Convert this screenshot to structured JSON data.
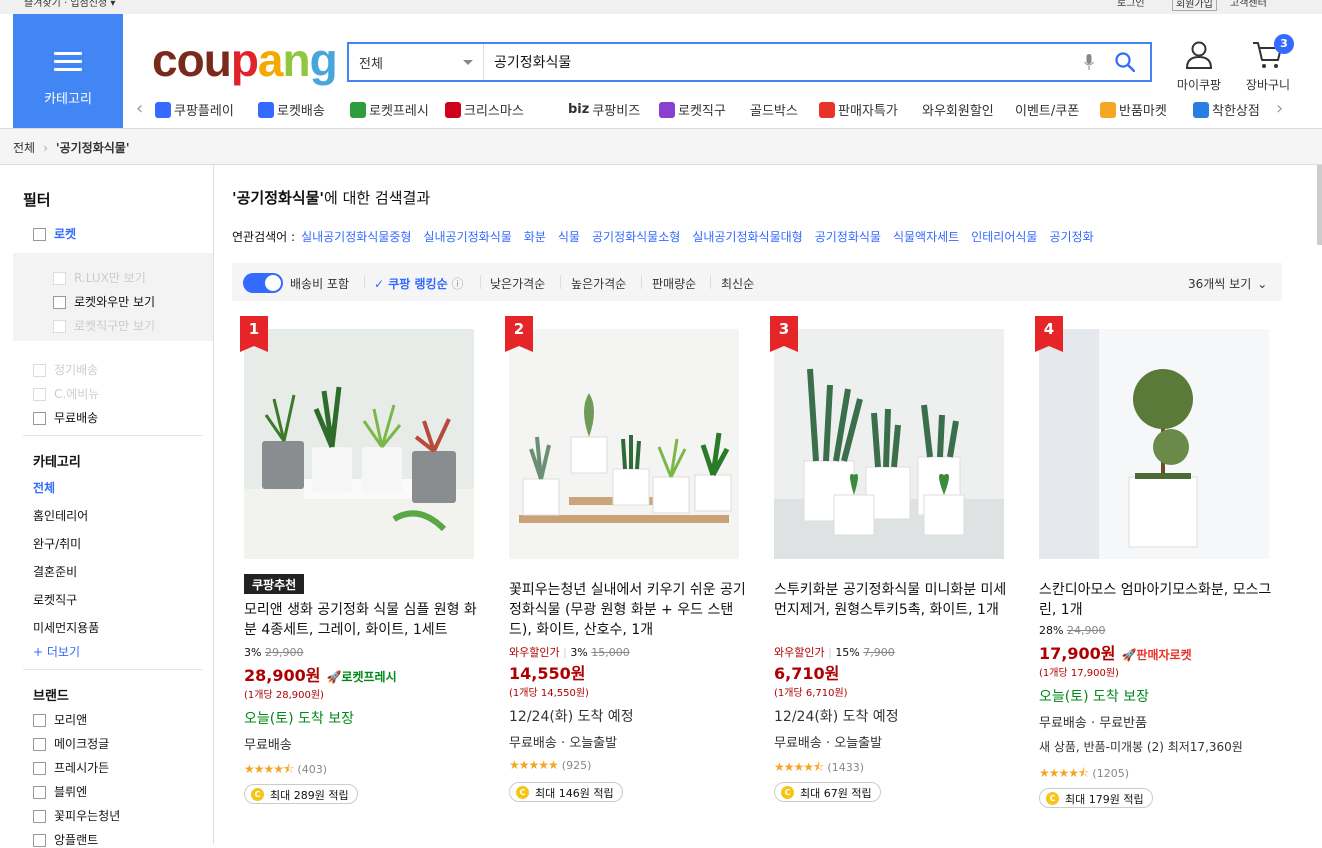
{
  "topbar": {
    "left": "즐겨찾기 · 입점신청 ▾",
    "login": "로그인",
    "signup": "회원가입",
    "cs": "고객센터"
  },
  "header": {
    "category_label": "카테고리",
    "logo_letters": [
      {
        "ch": "c",
        "color": "#7a2a1c"
      },
      {
        "ch": "o",
        "color": "#7a2a1c"
      },
      {
        "ch": "u",
        "color": "#7a2a1c"
      },
      {
        "ch": "p",
        "color": "#e1222a"
      },
      {
        "ch": "a",
        "color": "#f5a800"
      },
      {
        "ch": "n",
        "color": "#91c641"
      },
      {
        "ch": "g",
        "color": "#48a6dc"
      }
    ],
    "search_category": "전체",
    "search_query": "공기정화식물",
    "mycoupang_label": "마이쿠팡",
    "cart_label": "장바구니",
    "cart_count": "3"
  },
  "subnav": [
    {
      "label": "쿠팡플레이",
      "color": "#346aff"
    },
    {
      "label": "로켓배송",
      "color": "#346aff"
    },
    {
      "label": "로켓프레시",
      "color": "#2e9d3b"
    },
    {
      "label": "크리스마스",
      "color": "#d0021b"
    },
    {
      "label": "쿠팡비즈",
      "prefix": "biz"
    },
    {
      "label": "로켓직구",
      "color": "#8a3fd1"
    },
    {
      "label": "골드박스"
    },
    {
      "label": "판매자특가",
      "color": "#e8332a"
    },
    {
      "label": "와우회원할인"
    },
    {
      "label": "이벤트/쿠폰"
    },
    {
      "label": "반품마켓",
      "color": "#f5a623"
    },
    {
      "label": "착한상점",
      "color": "#2a7de1"
    }
  ],
  "breadcrumb": {
    "root": "전체",
    "current": "'공기정화식물'"
  },
  "sidebar": {
    "filter_title": "필터",
    "rocket": "로켓",
    "rlux": "R.LUX만 보기",
    "wow": "로켓와우만 보기",
    "jikgu": "로켓직구만 보기",
    "regular": "정기배송",
    "cmenu": "C.에비뉴",
    "free_ship": "무료배송",
    "category_title": "카테고리",
    "categories": [
      "전체",
      "홈인테리어",
      "완구/취미",
      "결혼준비",
      "로켓직구",
      "미세먼지용품"
    ],
    "more": "+ 더보기",
    "brand_title": "브랜드",
    "brands": [
      "모리앤",
      "메이크정글",
      "프레시가든",
      "블뤼엔",
      "꽃피우는청년",
      "앙플랜트"
    ]
  },
  "main": {
    "result_query": "'공기정화식물'",
    "result_suffix": "에 대한 검색결과",
    "related_label": "연관검색어 :",
    "related": [
      "실내공기정화식물중형",
      "실내공기정화식물",
      "화분",
      "식물",
      "공기정화식물소형",
      "실내공기정화식물대형",
      "공기정화식물",
      "식물액자세트",
      "인테리어식물",
      "공기정화"
    ],
    "sort": {
      "shipping_incl": "배송비 포함",
      "ranking": "쿠팡 랭킹순",
      "low": "낮은가격순",
      "high": "높은가격순",
      "sales": "판매량순",
      "newest": "최신순",
      "per_page": "36개씩 보기"
    }
  },
  "products": [
    {
      "rank": "1",
      "tag": "쿠팡추천",
      "name": "모리앤 생화 공기정화 식물 심플 원형 화분 4종세트, 그레이, 화이트, 1세트",
      "discount": "3%",
      "orig": "29,900",
      "price": "28,900원",
      "badge": "로켓프레시",
      "unit": "(1개당 28,900원)",
      "delivery": "오늘(토) 도착 보장",
      "delivery_green": true,
      "shipping": "무료배송",
      "rating": 4.5,
      "reviews": "(403)",
      "reward": "최대 289원 적립"
    },
    {
      "rank": "2",
      "prefix": "와우할인가",
      "name": "꽃피우는청년 실내에서 키우기 쉬운 공기정화식물 (무광 원형 화분 + 우드 스탠드), 화이트, 산호수, 1개",
      "discount": "3%",
      "orig": "15,000",
      "price": "14,550원",
      "unit": "(1개당 14,550원)",
      "delivery": "12/24(화) 도착 예정",
      "delivery_green": false,
      "shipping": "무료배송 · 오늘출발",
      "rating": 5,
      "reviews": "(925)",
      "reward": "최대 146원 적립"
    },
    {
      "rank": "3",
      "prefix": "와우할인가",
      "name": "스투키화분 공기정화식물 미니화분 미세먼지제거, 원형스투키5촉, 화이트, 1개",
      "discount": "15%",
      "orig": "7,900",
      "price": "6,710원",
      "unit": "(1개당 6,710원)",
      "delivery": "12/24(화) 도착 예정",
      "delivery_green": false,
      "shipping": "무료배송 · 오늘출발",
      "rating": 4.5,
      "reviews": "(1433)",
      "reward": "최대 67원 적립"
    },
    {
      "rank": "4",
      "name": "스칸디아모스 엄마아기모스화분, 모스그린, 1개",
      "discount": "28%",
      "orig": "24,900",
      "price": "17,900원",
      "badge": "판매자로켓",
      "unit": "(1개당 17,900원)",
      "delivery": "오늘(토) 도착 보장",
      "delivery_green": true,
      "shipping": "무료배송 · 무료반품",
      "extra": "새 상품, 반품-미개봉 (2) 최저17,360원",
      "rating": 4.5,
      "reviews": "(1205)",
      "reward": "최대 179원 적립"
    }
  ],
  "colors": {
    "accent": "#346aff",
    "price": "#ae0000",
    "rank": "#e52528",
    "green": "#00891a"
  }
}
